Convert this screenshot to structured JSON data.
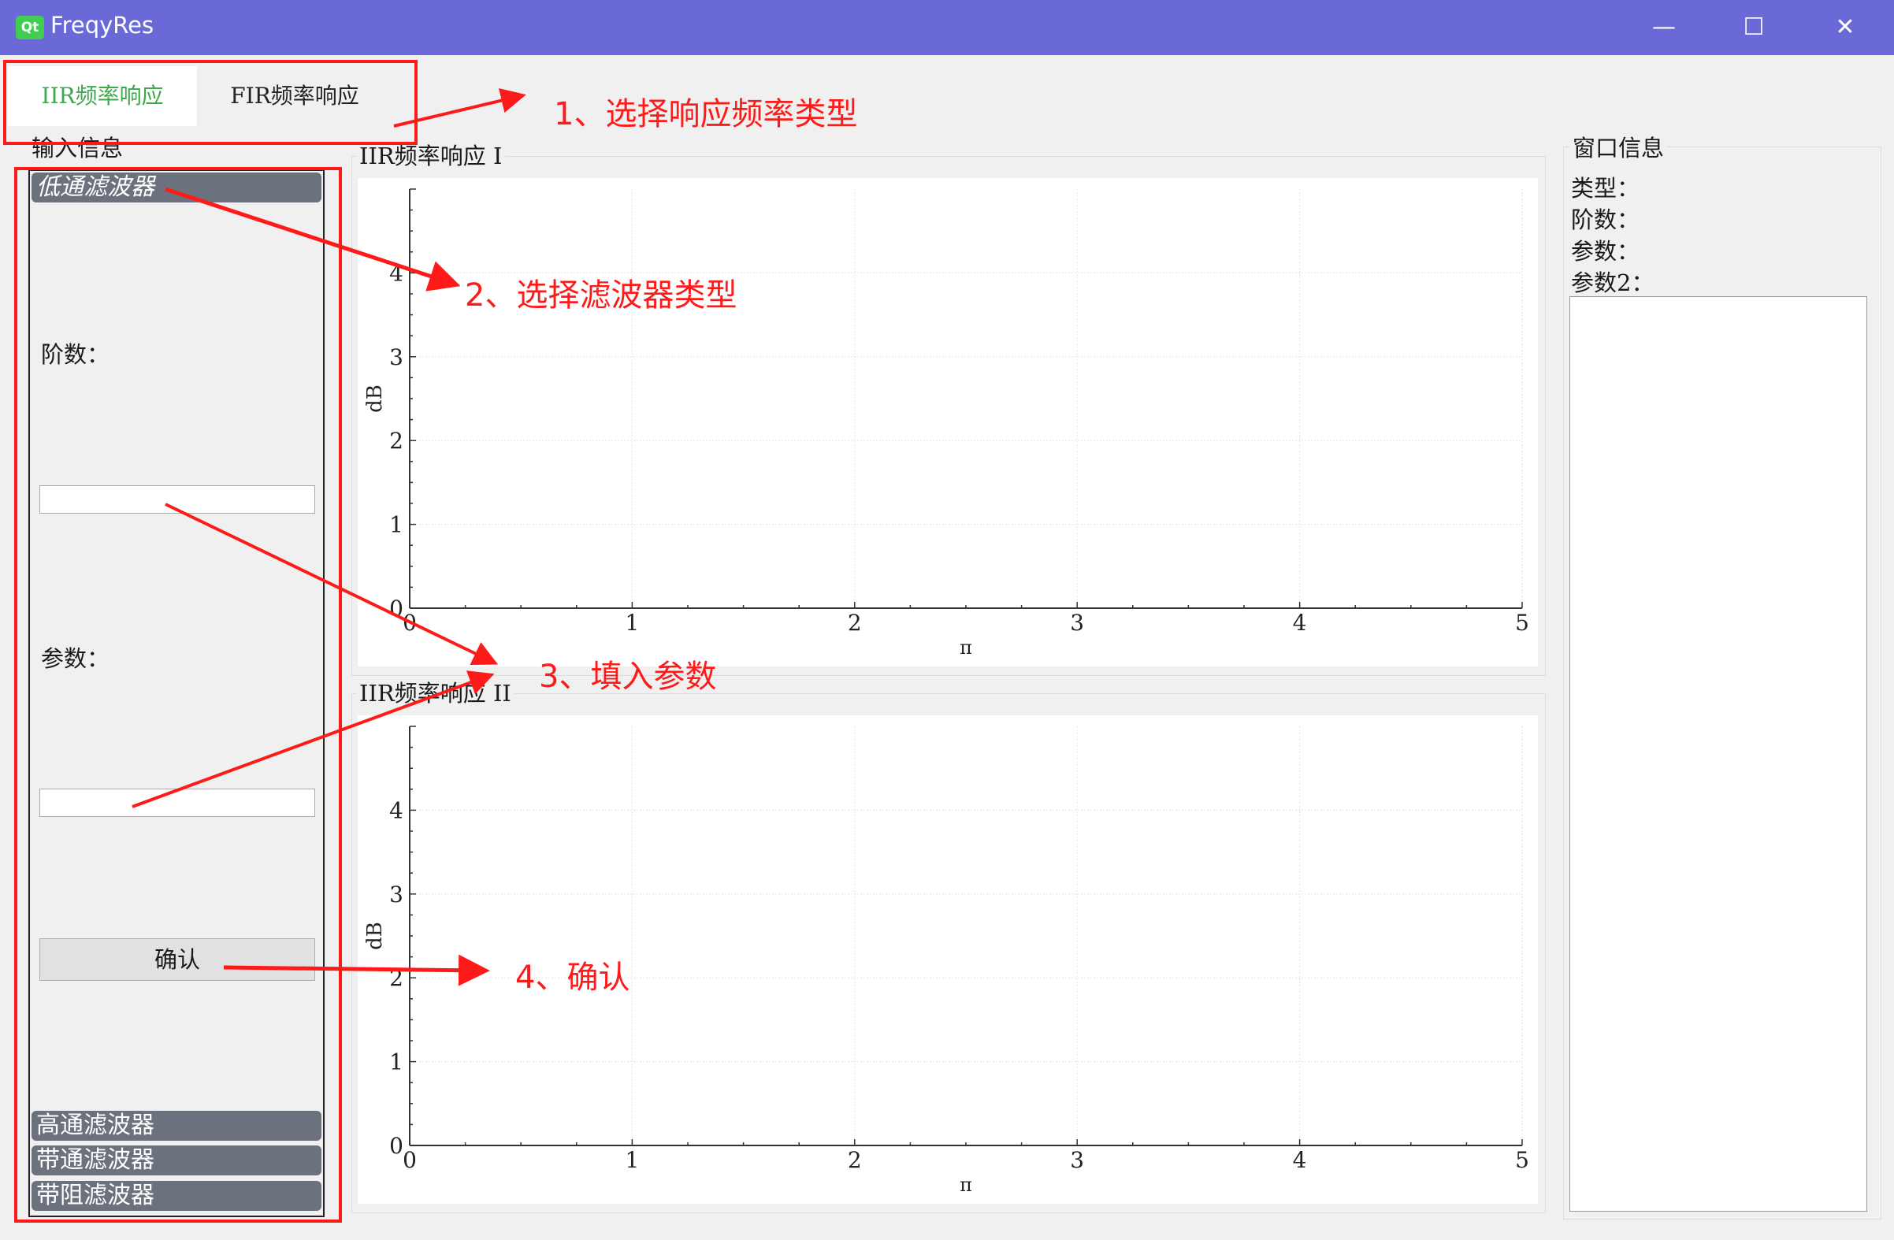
{
  "window": {
    "title": "FreqyRes",
    "logo_text": "Qt",
    "minimize": "—",
    "maximize": "☐",
    "close": "✕"
  },
  "tabs": [
    {
      "label": "IIR频率响应"
    },
    {
      "label": "FIR频率响应"
    }
  ],
  "input_panel": {
    "title": "输入信息",
    "sections": [
      {
        "label": "低通滤波器"
      },
      {
        "label": "高通滤波器"
      },
      {
        "label": "带通滤波器"
      },
      {
        "label": "带阻滤波器"
      }
    ],
    "order_label": "阶数：",
    "param_label": "参数：",
    "order_value": "",
    "param_value": "",
    "confirm": "确认"
  },
  "charts": [
    {
      "title": "IIR频率响应 I"
    },
    {
      "title": "IIR频率响应 II"
    }
  ],
  "chart_data": [
    {
      "type": "line",
      "title": "IIR频率响应 I",
      "xlabel": "π",
      "ylabel": "dB",
      "xlim": [
        0,
        5
      ],
      "ylim": [
        0,
        5
      ],
      "x_ticks": [
        "0",
        "1",
        "2",
        "3",
        "4",
        "5"
      ],
      "y_ticks": [
        "0",
        "1",
        "2",
        "3",
        "4"
      ],
      "grid": true,
      "series": []
    },
    {
      "type": "line",
      "title": "IIR频率响应 II",
      "xlabel": "π",
      "ylabel": "dB",
      "xlim": [
        0,
        5
      ],
      "ylim": [
        0,
        5
      ],
      "x_ticks": [
        "0",
        "1",
        "2",
        "3",
        "4",
        "5"
      ],
      "y_ticks": [
        "0",
        "1",
        "2",
        "3",
        "4"
      ],
      "grid": true,
      "series": []
    }
  ],
  "info_panel": {
    "title": "窗口信息",
    "type_label": "类型：",
    "order_label": "阶数：",
    "param_label": "参数：",
    "param2_label": "参数2：",
    "text": ""
  },
  "annotations": {
    "step1": "1、选择响应频率类型",
    "step2": "2、选择滤波器类型",
    "step3": "3、填入参数",
    "step4": "4、确认"
  },
  "colors": {
    "titlebar": "#6b69d8",
    "active_tab_text": "#3ea84f",
    "annotation": "#ff1a1a",
    "toolbox_header": "#6b717d"
  }
}
